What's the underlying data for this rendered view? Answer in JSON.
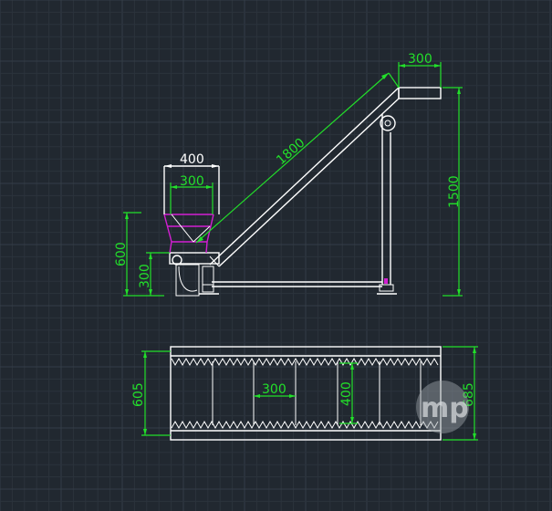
{
  "colors": {
    "background": "#212830",
    "outline": "#ffffff",
    "dimension": "#22e02a",
    "hopper": "#d21fd2",
    "watermark": "#cfd3d6"
  },
  "side_view": {
    "dim_hopper_top": "400",
    "dim_hopper_bottom": "300",
    "dim_incline_length": "1800",
    "dim_discharge_width": "300",
    "dim_total_height": "1500",
    "dim_hopper_height": "600",
    "dim_inlet_height": "300"
  },
  "top_view": {
    "dim_overall_width": "605",
    "dim_cleat_spacing": "300",
    "dim_cleat_height": "400",
    "dim_frame_width": "685"
  },
  "watermark": {
    "text": "mp",
    "icon": "mp-logo-icon"
  }
}
